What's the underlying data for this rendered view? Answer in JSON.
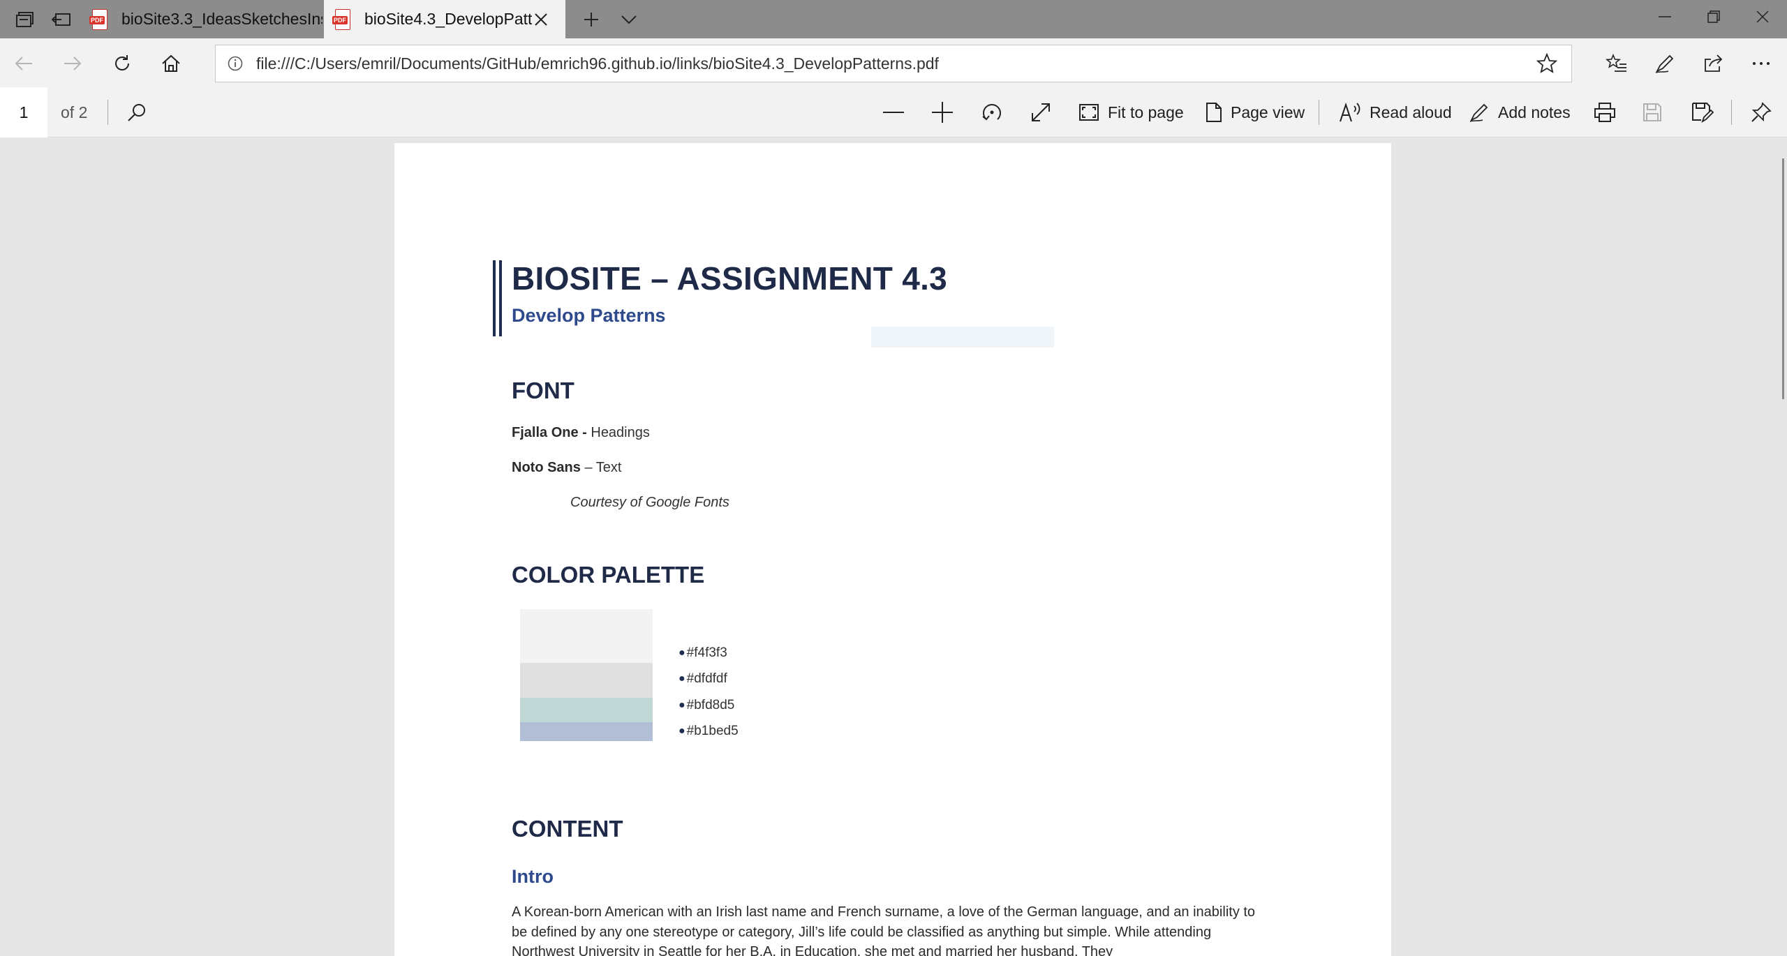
{
  "tabs": [
    {
      "title": "bioSite3.3_IdeasSketchesIns",
      "active": false,
      "icon": "pdf-icon",
      "icon_text": "PDF"
    },
    {
      "title": "bioSite4.3_DevelopPatte",
      "active": true,
      "icon": "pdf-icon",
      "icon_text": "PDF"
    }
  ],
  "address": {
    "url": "file:///C:/Users/emril/Documents/GitHub/emrich96.github.io/links/bioSite4.3_DevelopPatterns.pdf"
  },
  "pdf_toolbar": {
    "page_number": "1",
    "page_total": "of 2",
    "fit_to_page": "Fit to page",
    "page_view": "Page view",
    "read_aloud": "Read aloud",
    "add_notes": "Add notes"
  },
  "document": {
    "title": "BIOSITE – ASSIGNMENT 4.3",
    "subtitle": "Develop Patterns",
    "font_heading": "FONT",
    "font_lines": [
      {
        "name": "Fjalla One -",
        "use": " Headings"
      },
      {
        "name": "Noto Sans",
        "use": " – Text"
      }
    ],
    "font_credit": "Courtesy of Google Fonts",
    "palette_heading": "COLOR PALETTE",
    "palette": [
      "#f4f3f3",
      "#dfdfdf",
      "#bfd8d5",
      "#b1bed5"
    ],
    "palette_labels": [
      "#f4f3f3",
      "#dfdfdf",
      "#bfd8d5",
      "#b1bed5"
    ],
    "content_heading": "CONTENT",
    "intro_heading": "Intro",
    "intro_text": "A Korean-born American with an Irish last name and French surname, a love of the German language, and an inability to be defined by any one stereotype or category, Jill’s life could be classified as anything but simple. While attending Northwest University in Seattle for her B.A. in Education, she met and married her husband. They"
  },
  "colors": {
    "accent_dark": "#1f2a48",
    "accent_blue": "#2e4a8c",
    "titlebar": "#8c8c8c",
    "toolbar": "#f2f2f2"
  }
}
